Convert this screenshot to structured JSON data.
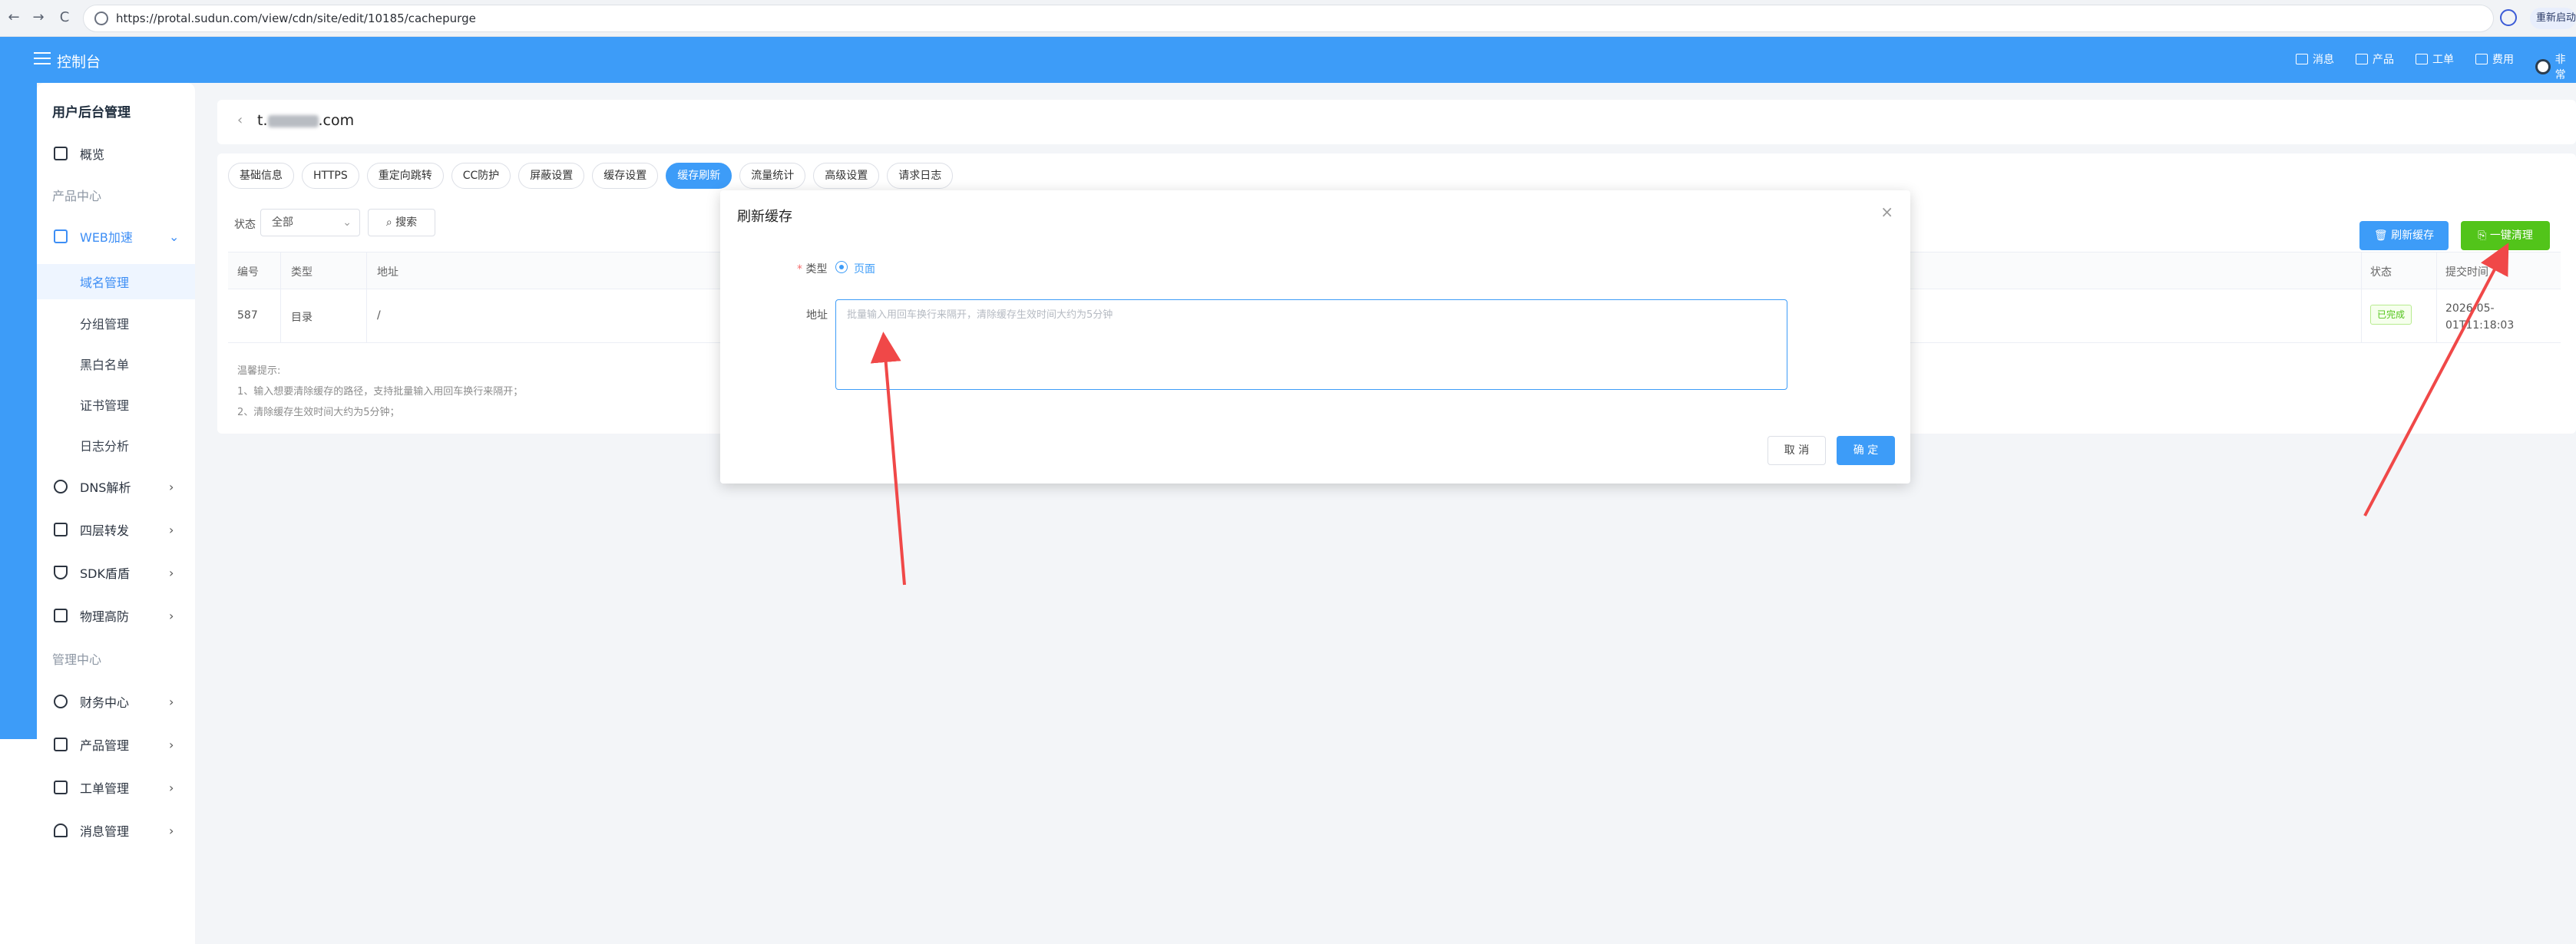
{
  "browser": {
    "back": "←",
    "forward": "→",
    "reload": "C",
    "url": "https://protal.sudun.com/view/cdn/site/edit/10185/cachepurge",
    "badge": "重新启动"
  },
  "header": {
    "title": "控制台",
    "items": [
      "消息",
      "产品",
      "工单",
      "费用",
      "非常"
    ]
  },
  "sidebar": {
    "title": "用户后台管理",
    "overview": "概览",
    "section_product": "产品中心",
    "web_accel": "WEB加速",
    "sub": [
      "域名管理",
      "分组管理",
      "黑白名单",
      "证书管理",
      "日志分析"
    ],
    "dns": "DNS解析",
    "l4": "四层转发",
    "sdk": "SDK盾盾",
    "phys": "物理高防",
    "section_mgmt": "管理中心",
    "finance": "财务中心",
    "product_mgmt": "产品管理",
    "ticket": "工单管理",
    "msg": "消息管理",
    "chevron": "›",
    "chevron_open": "⌄"
  },
  "domain": {
    "back": "‹",
    "prefix": "t.",
    "suffix": ".com"
  },
  "tabs": [
    "基础信息",
    "HTTPS",
    "重定向跳转",
    "CC防护",
    "屏蔽设置",
    "缓存设置",
    "缓存刷新",
    "流量统计",
    "高级设置",
    "请求日志"
  ],
  "filter": {
    "label": "状态",
    "value": "全部",
    "arrow": "⌄",
    "search": "⌕ 搜索"
  },
  "actions": {
    "refresh": "🗑 刷新缓存",
    "purge": "⎘ 一键清理"
  },
  "table": {
    "headers": {
      "id": "编号",
      "type": "类型",
      "addr": "地址",
      "status": "状态",
      "time": "提交时间"
    },
    "rows": [
      {
        "id": "587",
        "type": "目录",
        "addr": "/",
        "status": "已完成",
        "time": "2026-05-01T11:18:03"
      }
    ]
  },
  "tips": {
    "title": "温馨提示:",
    "line1": "1、输入想要清除缓存的路径，支持批量输入用回车换行来隔开；",
    "line2": "2、清除缓存生效时间大约为5分钟；"
  },
  "dialog": {
    "title": "刷新缓存",
    "close": "×",
    "type_label": "类型",
    "required": "*",
    "radio_label": "页面",
    "addr_label": "地址",
    "placeholder": "批量输入用回车换行来隔开，清除缓存生效时间大约为5分钟",
    "cancel": "取 消",
    "ok": "确 定"
  },
  "colors": {
    "primary": "#3d9cf8",
    "success": "#52c41a",
    "arrow": "#f04848"
  }
}
